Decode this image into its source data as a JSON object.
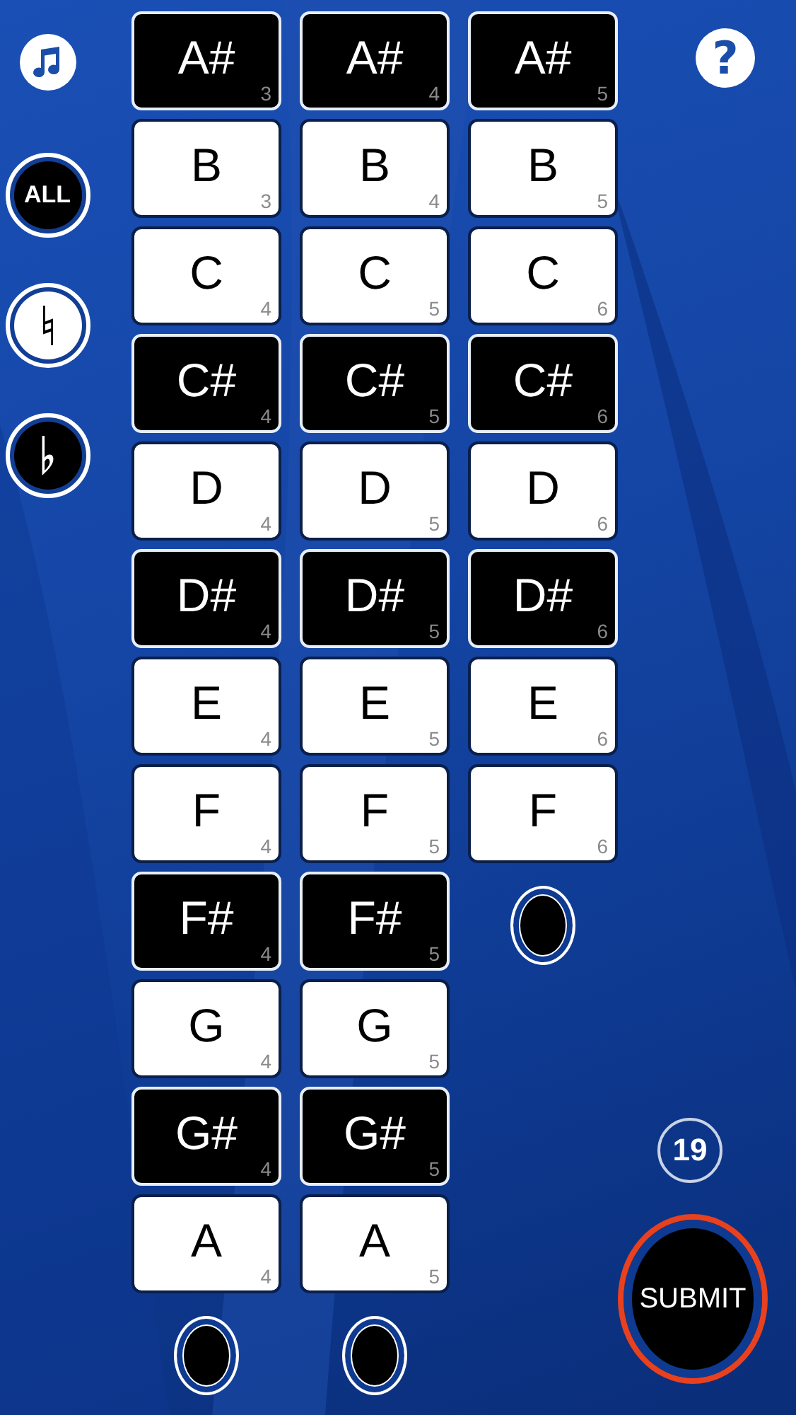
{
  "modes": [
    {
      "kind": "all",
      "label": "ALL",
      "selected": false
    },
    {
      "kind": "natural",
      "selected": true
    },
    {
      "kind": "flat",
      "selected": false
    }
  ],
  "help": "?",
  "columns": [
    {
      "keys": [
        {
          "note": "A#",
          "octave": "3",
          "kind": "black"
        },
        {
          "note": "B",
          "octave": "3",
          "kind": "white"
        },
        {
          "note": "C",
          "octave": "4",
          "kind": "white"
        },
        {
          "note": "C#",
          "octave": "4",
          "kind": "black"
        },
        {
          "note": "D",
          "octave": "4",
          "kind": "white"
        },
        {
          "note": "D#",
          "octave": "4",
          "kind": "black"
        },
        {
          "note": "E",
          "octave": "4",
          "kind": "white"
        },
        {
          "note": "F",
          "octave": "4",
          "kind": "white"
        },
        {
          "note": "F#",
          "octave": "4",
          "kind": "black"
        },
        {
          "note": "G",
          "octave": "4",
          "kind": "white"
        },
        {
          "note": "G#",
          "octave": "4",
          "kind": "black"
        },
        {
          "note": "A",
          "octave": "4",
          "kind": "white"
        }
      ]
    },
    {
      "keys": [
        {
          "note": "A#",
          "octave": "4",
          "kind": "black"
        },
        {
          "note": "B",
          "octave": "4",
          "kind": "white"
        },
        {
          "note": "C",
          "octave": "5",
          "kind": "white"
        },
        {
          "note": "C#",
          "octave": "5",
          "kind": "black"
        },
        {
          "note": "D",
          "octave": "5",
          "kind": "white"
        },
        {
          "note": "D#",
          "octave": "5",
          "kind": "black"
        },
        {
          "note": "E",
          "octave": "5",
          "kind": "white"
        },
        {
          "note": "F",
          "octave": "5",
          "kind": "white"
        },
        {
          "note": "F#",
          "octave": "5",
          "kind": "black"
        },
        {
          "note": "G",
          "octave": "5",
          "kind": "white"
        },
        {
          "note": "G#",
          "octave": "5",
          "kind": "black"
        },
        {
          "note": "A",
          "octave": "5",
          "kind": "white"
        }
      ]
    },
    {
      "keys": [
        {
          "note": "A#",
          "octave": "5",
          "kind": "black"
        },
        {
          "note": "B",
          "octave": "5",
          "kind": "white"
        },
        {
          "note": "C",
          "octave": "6",
          "kind": "white"
        },
        {
          "note": "C#",
          "octave": "6",
          "kind": "black"
        },
        {
          "note": "D",
          "octave": "6",
          "kind": "white"
        },
        {
          "note": "D#",
          "octave": "6",
          "kind": "black"
        },
        {
          "note": "E",
          "octave": "6",
          "kind": "white"
        },
        {
          "note": "F",
          "octave": "6",
          "kind": "white"
        }
      ]
    }
  ],
  "counter": "19",
  "submit": "SUBMIT"
}
